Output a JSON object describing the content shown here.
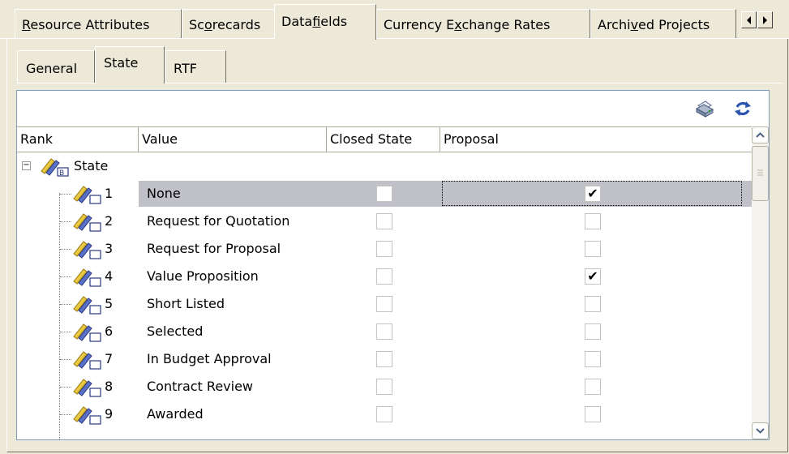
{
  "top_tabs": [
    {
      "pre": "",
      "ul": "R",
      "post": "esource Attributes"
    },
    {
      "pre": "Sc",
      "ul": "o",
      "post": "recards"
    },
    {
      "pre": "Data",
      "ul": "f",
      "post": "ields"
    },
    {
      "pre": "Currency E",
      "ul": "x",
      "post": "change Rates"
    },
    {
      "pre": "Archi",
      "ul": "v",
      "post": "ed Projects"
    }
  ],
  "active_top_tab": "Datafields",
  "sub_tabs": [
    "General",
    "State",
    "RTF"
  ],
  "active_sub_tab": "State",
  "toolbar": {
    "print_icon": "printer-icon",
    "refresh_icon": "refresh-icon"
  },
  "columns": [
    "Rank",
    "Value",
    "Closed State",
    "Proposal"
  ],
  "root": {
    "label": "State",
    "icon": "state-node-icon"
  },
  "rows": [
    {
      "rank": "1",
      "value": "None",
      "closed": false,
      "proposal": true,
      "selected": true
    },
    {
      "rank": "2",
      "value": "Request for Quotation",
      "closed": false,
      "proposal": false
    },
    {
      "rank": "3",
      "value": "Request for Proposal",
      "closed": false,
      "proposal": false
    },
    {
      "rank": "4",
      "value": "Value Proposition",
      "closed": false,
      "proposal": true
    },
    {
      "rank": "5",
      "value": "Short Listed",
      "closed": false,
      "proposal": false
    },
    {
      "rank": "6",
      "value": "Selected",
      "closed": false,
      "proposal": false
    },
    {
      "rank": "7",
      "value": "In Budget Approval",
      "closed": false,
      "proposal": false
    },
    {
      "rank": "8",
      "value": "Contract Review",
      "closed": false,
      "proposal": false
    },
    {
      "rank": "9",
      "value": "Awarded",
      "closed": false,
      "proposal": false
    }
  ],
  "colors": {
    "window_bg": "#ece9d8",
    "selected_row": "#c0c0c8",
    "border_blue": "#7f9db9"
  }
}
